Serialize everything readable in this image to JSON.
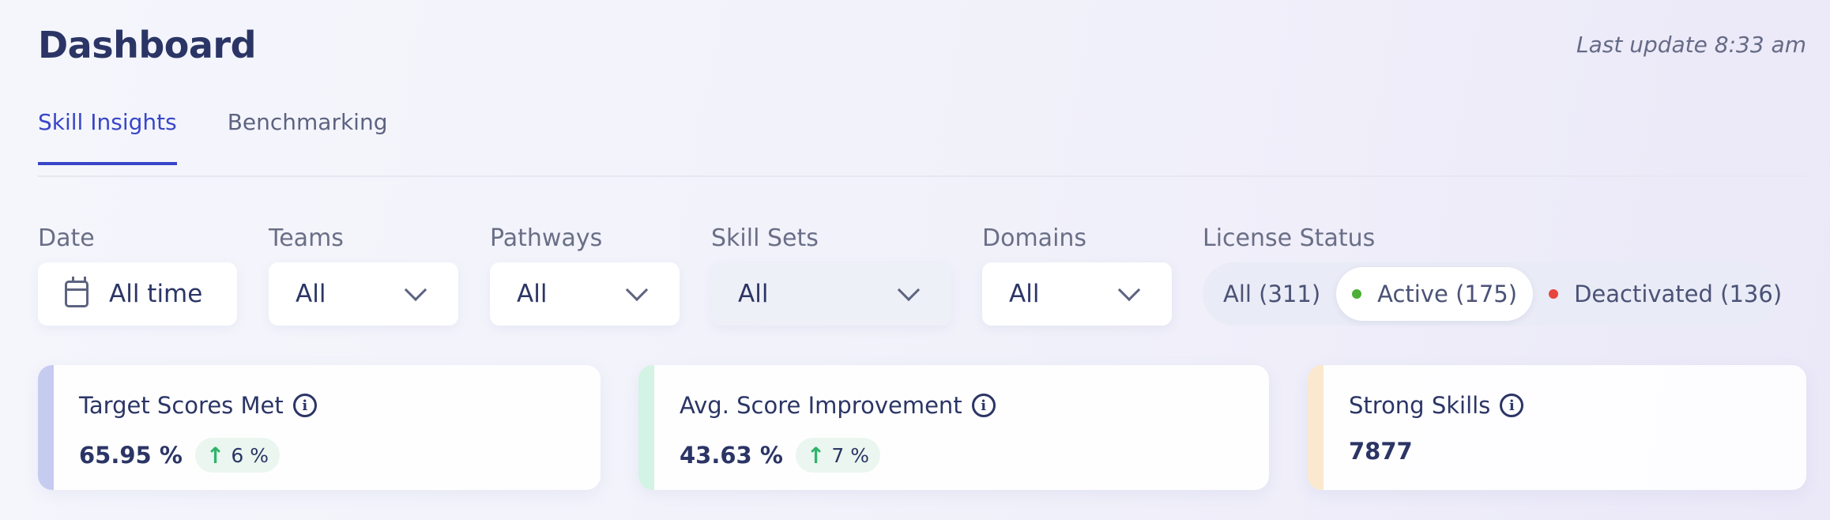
{
  "header": {
    "title": "Dashboard",
    "last_update": "Last update 8:33 am"
  },
  "tabs": [
    {
      "label": "Skill Insights",
      "active": true
    },
    {
      "label": "Benchmarking",
      "active": false
    }
  ],
  "filters": {
    "date": {
      "label": "Date",
      "value": "All time",
      "icon": "calendar-icon"
    },
    "teams": {
      "label": "Teams",
      "value": "All"
    },
    "pathways": {
      "label": "Pathways",
      "value": "All"
    },
    "skill_sets": {
      "label": "Skill Sets",
      "value": "All"
    },
    "domains": {
      "label": "Domains",
      "value": "All"
    },
    "license_status": {
      "label": "License Status",
      "options": [
        {
          "label": "All (311)",
          "selected": false
        },
        {
          "label": "Active (175)",
          "selected": true,
          "dot_color": "#4caf35"
        },
        {
          "label": "Deactivated (136)",
          "selected": false,
          "dot_color": "#e8453c"
        }
      ]
    }
  },
  "cards": [
    {
      "title": "Target Scores Met",
      "value": "65.95 %",
      "delta": "6 %",
      "accent": "#c6cbf0"
    },
    {
      "title": "Avg. Score Improvement",
      "value": "43.63 %",
      "delta": "7 %",
      "accent": "#d3f3e4"
    },
    {
      "title": "Strong Skills",
      "value": "7877",
      "accent": "#fbe9cf"
    }
  ],
  "colors": {
    "primary": "#3946c8",
    "text": "#2b3565",
    "positive": "#2fb36b"
  }
}
